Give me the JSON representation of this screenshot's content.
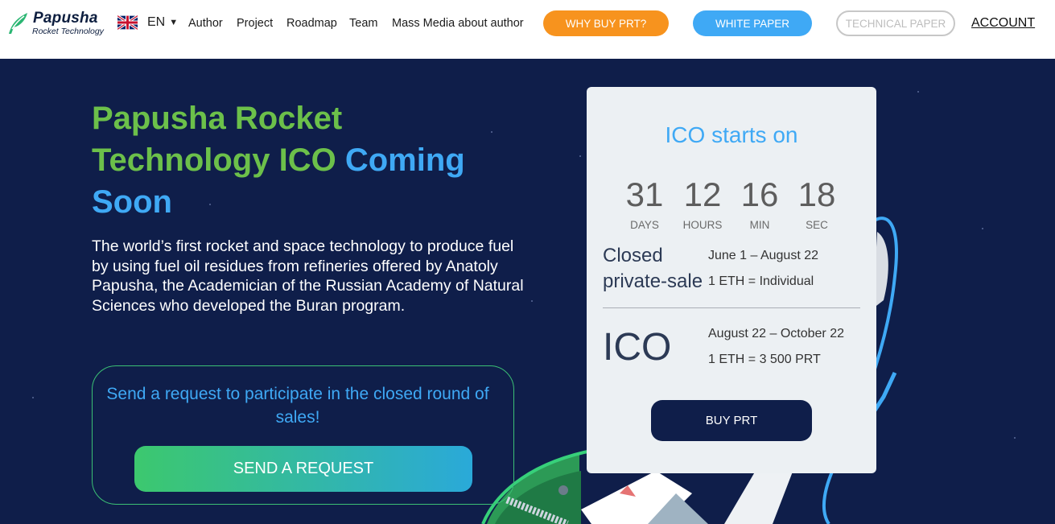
{
  "header": {
    "logo": {
      "name": "Papusha",
      "subtitle": "Rocket Technology"
    },
    "language": {
      "code": "EN",
      "flag": "uk-flag-icon"
    },
    "nav": [
      "Author",
      "Project",
      "Roadmap",
      "Team",
      "Mass Media about author"
    ],
    "buttons": {
      "why_buy": "WHY BUY PRT?",
      "white_paper": "WHITE PAPER",
      "technical_paper": "TECHNICAL PAPER"
    },
    "account": "ACCOUNT"
  },
  "hero": {
    "title_green": "Papusha Rocket Technology ICO",
    "title_blue": "Coming Soon",
    "description": "The world’s first rocket and space technology to produce fuel by using fuel oil residues from refineries offered by Anatoly Papusha, the Academician of the Russian Academy of Natural Sciences who developed the Buran program.",
    "request": {
      "text": "Send a request to participate in the closed round of sales!",
      "button": "SEND A REQUEST"
    }
  },
  "ico_card": {
    "title": "ICO starts on",
    "countdown": [
      {
        "value": "31",
        "label": "DAYS"
      },
      {
        "value": "12",
        "label": "HOURS"
      },
      {
        "value": "16",
        "label": "MIN"
      },
      {
        "value": "18",
        "label": "SEC"
      }
    ],
    "stages": [
      {
        "name_line1": "Closed",
        "name_line2": "private-sale",
        "dates": "June 1 – August 22",
        "rate": "1 ETH = Individual"
      },
      {
        "name": "ICO",
        "dates": "August 22 – October 22",
        "rate": "1 ETH = 3 500 PRT"
      }
    ],
    "buy_button": "BUY PRT"
  },
  "colors": {
    "brand_green": "#6cc04a",
    "brand_blue": "#3fa9f5",
    "navy": "#0f1e4a",
    "orange": "#f7931e"
  }
}
